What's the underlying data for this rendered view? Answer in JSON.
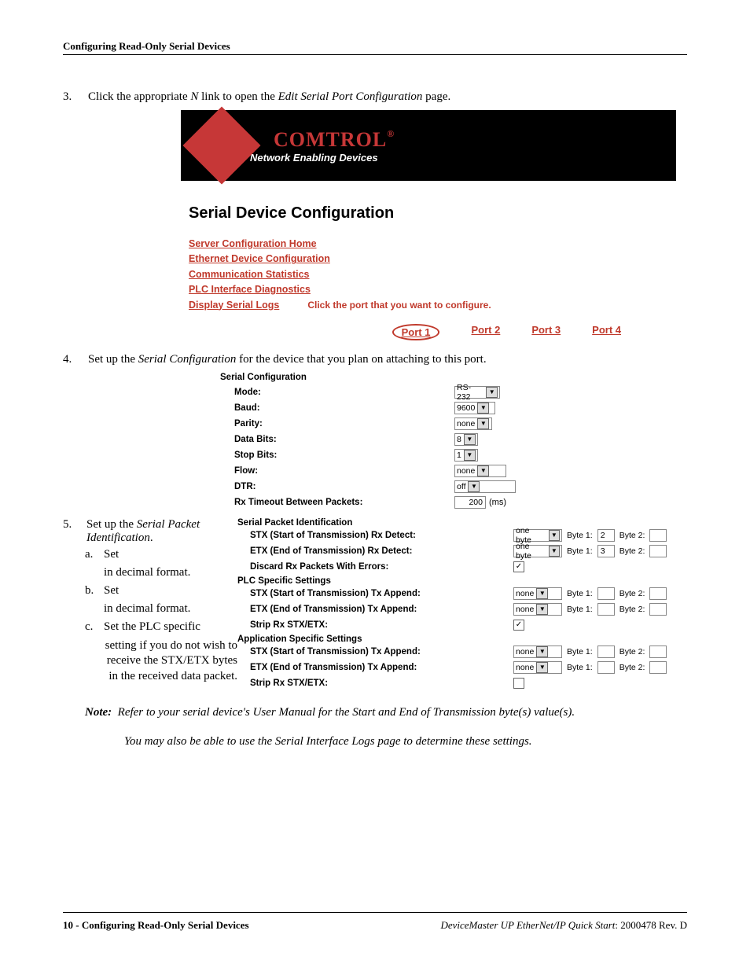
{
  "header": {
    "title": "Configuring Read-Only Serial Devices"
  },
  "step3": {
    "num": "3.",
    "pre": "Click the appropriate ",
    "var": "N",
    "mid": " link to open the ",
    "page": "Edit Serial Port Configuration",
    "post": " page."
  },
  "app": {
    "logo_text": "COMTROL",
    "reg": "®",
    "tagline": "Network Enabling Devices",
    "title": "Serial Device Configuration",
    "nav": [
      "Server Configuration Home",
      "Ethernet Device Configuration",
      "Communication Statistics",
      "PLC Interface Diagnostics",
      "Display Serial Logs"
    ],
    "click_hint": "Click the port that you want to configure.",
    "ports": [
      "Port 1",
      "Port 2",
      "Port 3",
      "Port 4"
    ]
  },
  "step4": {
    "num": "4.",
    "pre": "Set up the ",
    "em": "Serial Configuration",
    "post": " for the device that you plan on attaching to this port."
  },
  "cfg": {
    "title": "Serial Configuration",
    "rows": {
      "mode": {
        "label": "Mode:",
        "value": "RS-232"
      },
      "baud": {
        "label": "Baud:",
        "value": "9600"
      },
      "parity": {
        "label": "Parity:",
        "value": "none"
      },
      "data": {
        "label": "Data Bits:",
        "value": "8"
      },
      "stop": {
        "label": "Stop Bits:",
        "value": "1"
      },
      "flow": {
        "label": "Flow:",
        "value": "none"
      },
      "dtr": {
        "label": "DTR:",
        "value": "off"
      },
      "rx": {
        "label": "Rx Timeout Between Packets:",
        "value": "200",
        "unit": "(ms)"
      }
    }
  },
  "step5": {
    "num": "5.",
    "line1_pre": "Set up the ",
    "line1_em": "Serial Packet Identification",
    "line1_post": ".",
    "a_mk": "a.",
    "a_txt": "Set",
    "a_sub": "in decimal format.",
    "b_mk": "b.",
    "b_txt": "Set",
    "b_sub": "in decimal format.",
    "c_mk": "c.",
    "c_txt": "Set the PLC specific",
    "c_sub": "setting if you do not wish to receive the STX/ETX bytes in the received data packet."
  },
  "pkt": {
    "sec1": "Serial Packet Identification",
    "stx_rx": {
      "label": "STX (Start of Transmission) Rx Detect:",
      "sel": "one byte",
      "b1l": "Byte 1:",
      "b1": "2",
      "b2l": "Byte 2:"
    },
    "etx_rx": {
      "label": "ETX (End of Transmission) Rx Detect:",
      "sel": "one byte",
      "b1l": "Byte 1:",
      "b1": "3",
      "b2l": "Byte 2:"
    },
    "discard": {
      "label": "Discard Rx Packets With Errors:"
    },
    "sec2": "PLC Specific Settings",
    "plc_stx": {
      "label": "STX (Start of Transmission) Tx Append:",
      "sel": "none",
      "b1l": "Byte 1:",
      "b2l": "Byte 2:"
    },
    "plc_etx": {
      "label": "ETX (End of Transmission) Tx Append:",
      "sel": "none",
      "b1l": "Byte 1:",
      "b2l": "Byte 2:"
    },
    "plc_strip": {
      "label": "Strip Rx STX/ETX:"
    },
    "sec3": "Application Specific Settings",
    "app_stx": {
      "label": "STX (Start of Transmission) Tx Append:",
      "sel": "none",
      "b1l": "Byte 1:",
      "b2l": "Byte 2:"
    },
    "app_etx": {
      "label": "ETX (End of Transmission) Tx Append:",
      "sel": "none",
      "b1l": "Byte 1:",
      "b2l": "Byte 2:"
    },
    "app_strip": {
      "label": "Strip Rx STX/ETX:"
    }
  },
  "note": {
    "label": "Note:",
    "l1": "Refer to your serial device's User Manual for the Start and End of Transmission byte(s) value(s).",
    "l2": "You may also be able to use the Serial Interface Logs page to determine these settings."
  },
  "footer": {
    "left_page": "10 - ",
    "left_title": "Configuring Read-Only Serial Devices",
    "right_title": "DeviceMaster UP EtherNet/IP Quick Start",
    "right_rev": ": 2000478 Rev. D"
  }
}
